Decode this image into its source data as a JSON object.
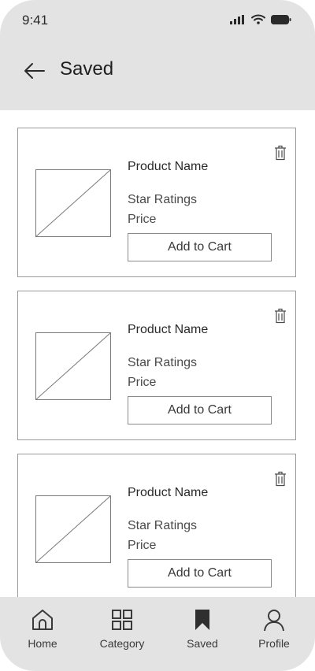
{
  "status_bar": {
    "time": "9:41"
  },
  "header": {
    "title": "Saved"
  },
  "products": [
    {
      "name": "Product Name",
      "rating": "Star Ratings",
      "price": "Price",
      "cart_label": "Add to Cart"
    },
    {
      "name": "Product Name",
      "rating": "Star Ratings",
      "price": "Price",
      "cart_label": "Add to Cart"
    },
    {
      "name": "Product Name",
      "rating": "Star Ratings",
      "price": "Price",
      "cart_label": "Add to Cart"
    }
  ],
  "tabbar": {
    "items": [
      {
        "label": "Home",
        "icon": "home-icon"
      },
      {
        "label": "Category",
        "icon": "grid-icon"
      },
      {
        "label": "Saved",
        "icon": "bookmark-icon",
        "active": true
      },
      {
        "label": "Profile",
        "icon": "user-icon"
      }
    ]
  }
}
